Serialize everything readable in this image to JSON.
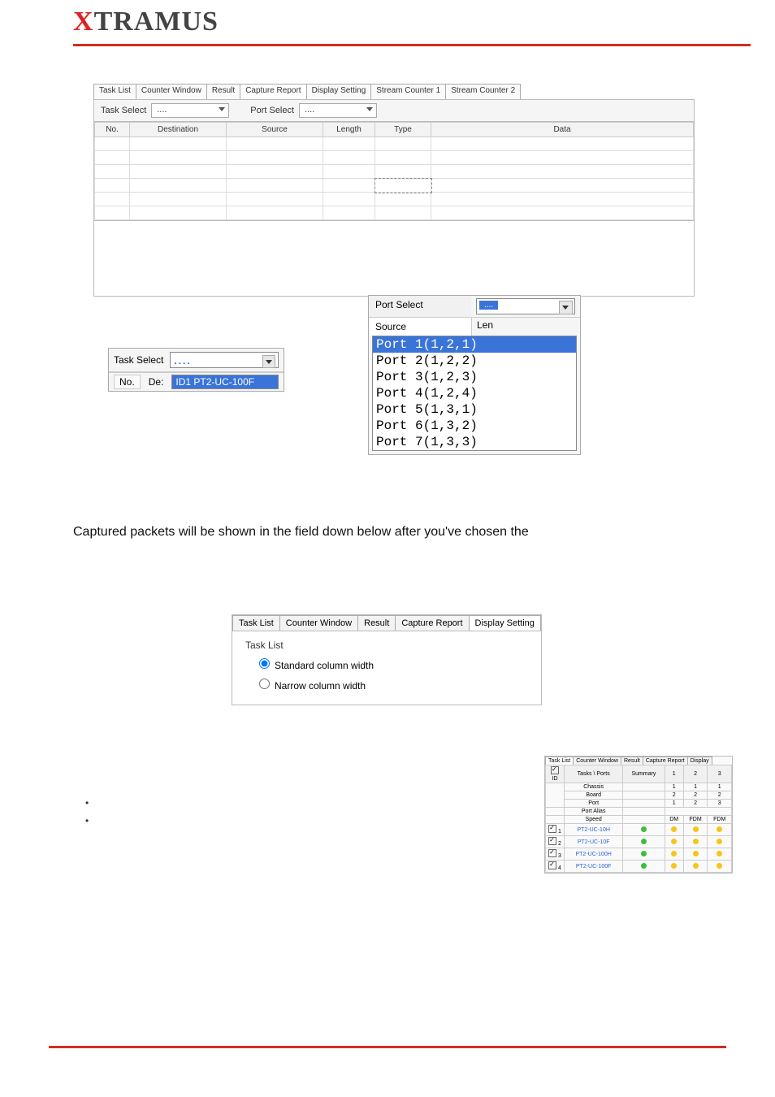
{
  "logo": {
    "pre": "X",
    "rest": "TRAMUS"
  },
  "panelA": {
    "tabs": [
      "Task List",
      "Counter Window",
      "Result",
      "Capture Report",
      "Display Setting",
      "Stream Counter 1",
      "Stream Counter 2"
    ],
    "activeTab": 3,
    "taskSelectLabel": "Task Select",
    "taskSelectValue": "....",
    "portSelectLabel": "Port Select",
    "portSelectValue": "....",
    "cols": {
      "no": "No.",
      "dest": "Destination",
      "src": "Source",
      "len": "Length",
      "type": "Type",
      "data": "Data"
    }
  },
  "dd1": {
    "label": "Task Select",
    "value": "....",
    "noLabel": "No.",
    "dePrefix": "De:",
    "option": "ID1 PT2-UC-100F"
  },
  "dd2": {
    "portSelectLabel": "Port Select",
    "portSelectValue": "....",
    "sourceLabel": "Source",
    "lenPrefix": "Len",
    "ports": [
      "Port 1(1,2,1)",
      "Port 2(1,2,2)",
      "Port 3(1,2,3)",
      "Port 4(1,2,4)",
      "Port 5(1,3,1)",
      "Port 6(1,3,2)",
      "Port 7(1,3,3)"
    ]
  },
  "caption": "Captured packets will be shown in the field down below after you've chosen the",
  "panelC": {
    "tabs": [
      "Task List",
      "Counter Window",
      "Result",
      "Capture Report",
      "Display Setting"
    ],
    "activeTab": 4,
    "group": "Task List",
    "r1": "Standard column width",
    "r2": "Narrow column width"
  },
  "mini": {
    "tabs": [
      "Task List",
      "Counter Window",
      "Result",
      "Capture Report",
      "Display"
    ],
    "hdr": {
      "id": "ID",
      "tasks": "Tasks \\ Ports",
      "summary": "Summary",
      "c1": "1",
      "c2": "2",
      "c3": "3"
    },
    "rowsA": [
      {
        "k": "Chassis",
        "v": [
          "1",
          "1",
          "1"
        ]
      },
      {
        "k": "Board",
        "v": [
          "2",
          "2",
          "2"
        ]
      },
      {
        "k": "Port",
        "v": [
          "1",
          "2",
          "3"
        ]
      }
    ],
    "alias": "Port Alias",
    "speed": "Speed",
    "speedR": [
      "DM",
      "FDM",
      "FDM"
    ],
    "rows": [
      {
        "n": "1",
        "name": "PT2-UC-10H"
      },
      {
        "n": "2",
        "name": "PT2-UC-10F"
      },
      {
        "n": "3",
        "name": "PT2-UC-100H"
      },
      {
        "n": "4",
        "name": "PT2-UC-100F"
      }
    ]
  }
}
